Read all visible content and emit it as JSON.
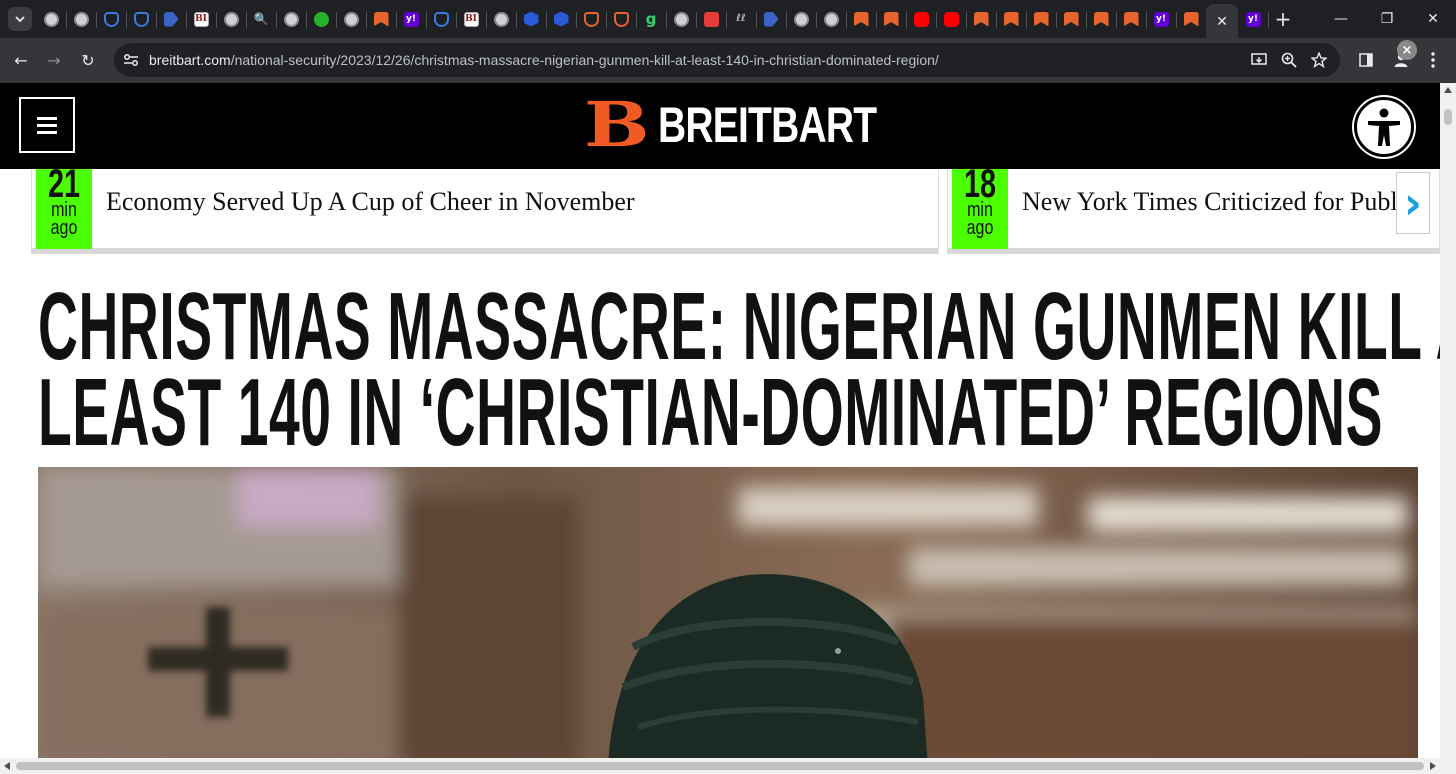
{
  "browser": {
    "tabs": [
      {
        "icon": "globe-icon"
      },
      {
        "icon": "globe-icon"
      },
      {
        "icon": "shield-icon"
      },
      {
        "icon": "shield-icon"
      },
      {
        "icon": "blue-arrow-icon"
      },
      {
        "icon": "bi-icon",
        "text": "BI"
      },
      {
        "icon": "globe-icon"
      },
      {
        "icon": "search-icon",
        "text": "🔍"
      },
      {
        "icon": "globe-icon"
      },
      {
        "icon": "play-icon"
      },
      {
        "icon": "globe-icon"
      },
      {
        "icon": "breitbart-icon"
      },
      {
        "icon": "yahoo-icon",
        "text": "y!"
      },
      {
        "icon": "shield-icon"
      },
      {
        "icon": "bi-icon",
        "text": "BI"
      },
      {
        "icon": "globe-icon"
      },
      {
        "icon": "hex-icon"
      },
      {
        "icon": "hex-icon"
      },
      {
        "icon": "orange-shield-icon"
      },
      {
        "icon": "orange-shield-icon"
      },
      {
        "icon": "g-icon",
        "text": "g"
      },
      {
        "icon": "globe-icon"
      },
      {
        "icon": "red-mic-icon"
      },
      {
        "icon": "slash-icon",
        "text": "ℓℓ"
      },
      {
        "icon": "blue-arrow-icon"
      },
      {
        "icon": "globe-icon"
      },
      {
        "icon": "globe-icon"
      },
      {
        "icon": "breitbart-icon"
      },
      {
        "icon": "breitbart-icon"
      },
      {
        "icon": "youtube-icon"
      },
      {
        "icon": "youtube-icon"
      },
      {
        "icon": "breitbart-icon"
      },
      {
        "icon": "breitbart-icon"
      },
      {
        "icon": "breitbart-icon"
      },
      {
        "icon": "breitbart-icon"
      },
      {
        "icon": "breitbart-icon"
      },
      {
        "icon": "breitbart-icon"
      },
      {
        "icon": "yahoo-icon",
        "text": "y!"
      },
      {
        "icon": "breitbart-icon"
      }
    ],
    "active_tab_close": "✕",
    "after_active_tab": {
      "icon": "yahoo-icon",
      "text": "y!"
    },
    "new_tab": "+",
    "window_controls": {
      "minimize": "—",
      "maximize": "❐",
      "close": "✕"
    },
    "url_host": "breitbart.com",
    "url_path": "/national-security/2023/12/26/christmas-massacre-nigerian-gunmen-kill-at-least-140-in-christian-dominated-region/",
    "nav": {
      "back": "←",
      "forward": "→",
      "reload": "↻"
    }
  },
  "site": {
    "logo_mark": "B",
    "logo_text": "BREITBART",
    "brand_color": "#f15a22"
  },
  "ticker": [
    {
      "num": "21",
      "unit": "min",
      "ago": "ago",
      "text": "Economy Served Up A Cup of Cheer in November"
    },
    {
      "num": "18",
      "unit": "min",
      "ago": "ago",
      "text": "New York Times Criticized for Publ"
    }
  ],
  "ticker_next": "›",
  "article": {
    "headline_line1": "CHRISTMAS MASSACRE: NIGERIAN GUNMEN KILL AT",
    "headline_line2": "LEAST 140 IN ‘CHRISTIAN-DOMINATED’ REGIONS"
  }
}
